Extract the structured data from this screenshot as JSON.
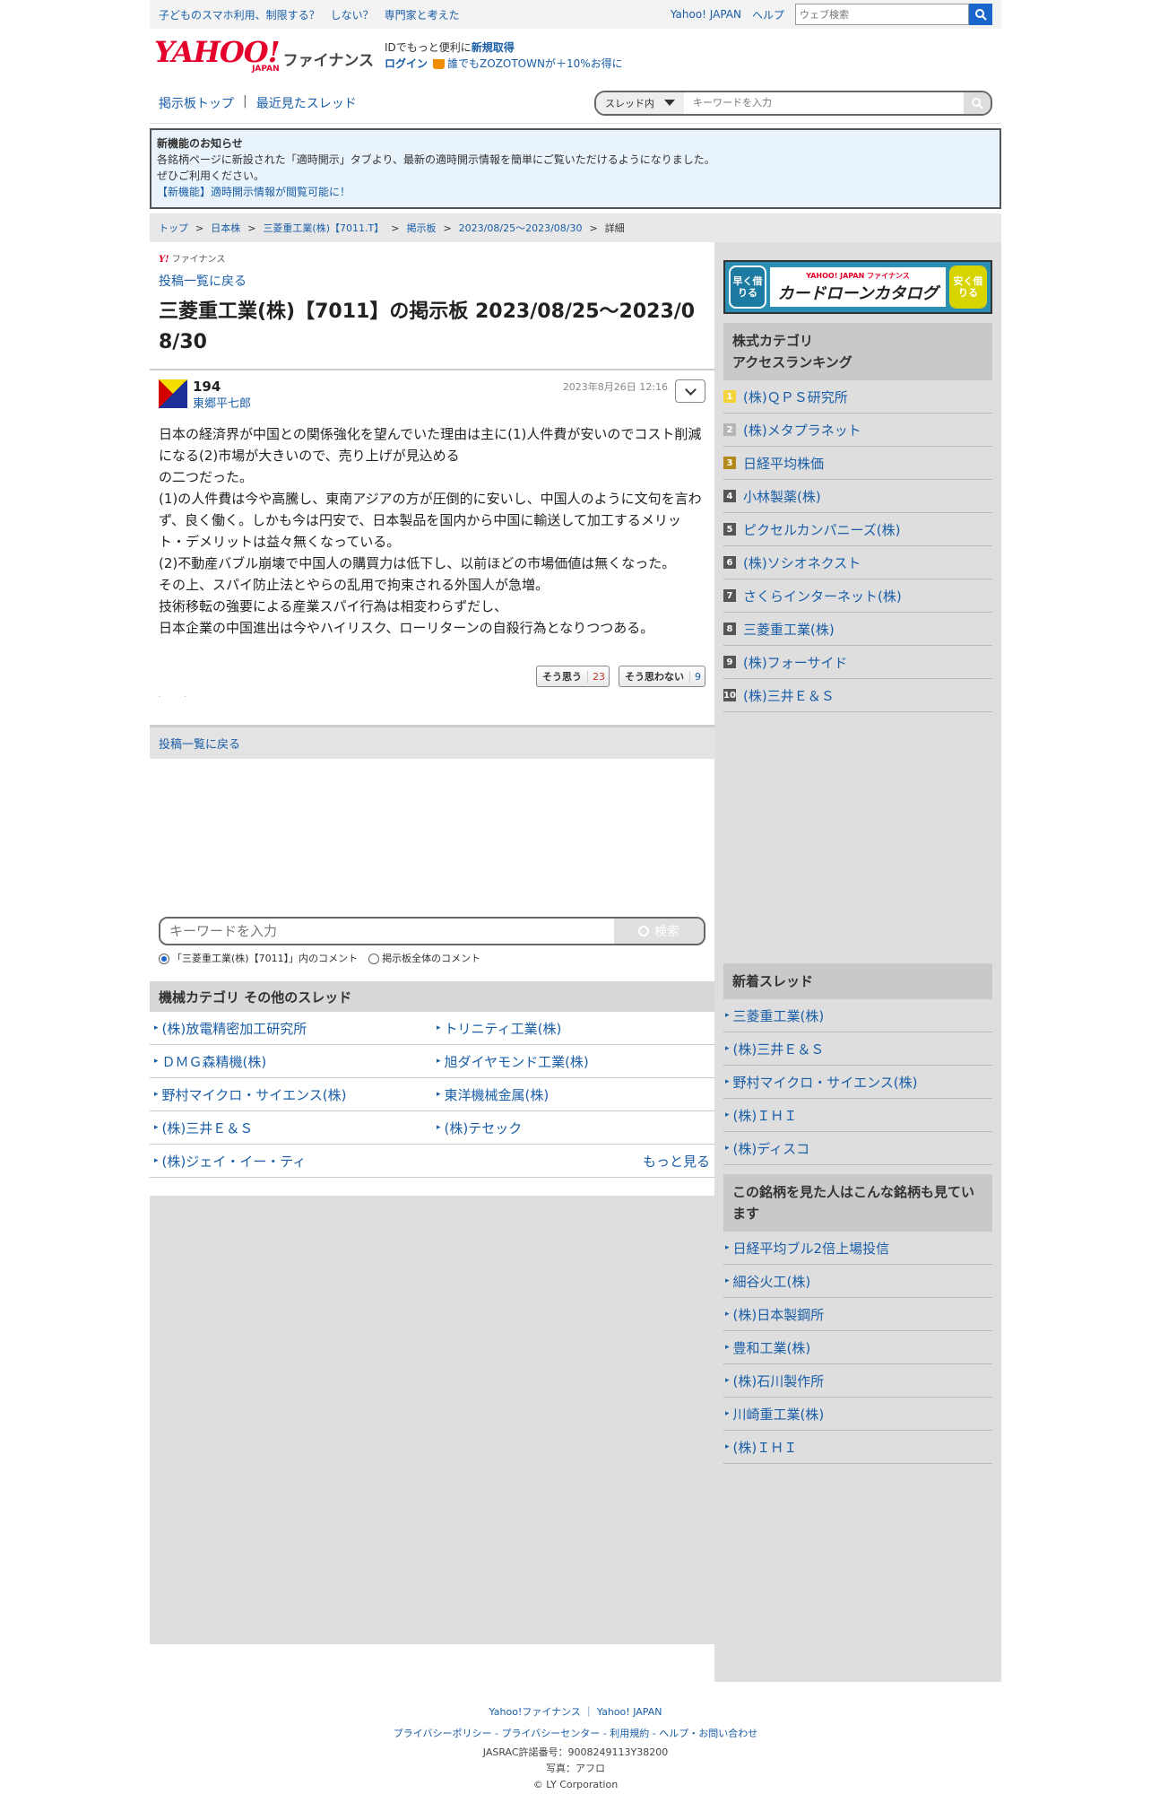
{
  "topbar": {
    "links": [
      "子どものスマホ利用、制限する？　しない？　専門家と考えた"
    ],
    "right_links": [
      "Yahoo! JAPAN",
      "ヘルプ"
    ],
    "search_placeholder": "ウェブ検索"
  },
  "header": {
    "logo_text": "YAHOO!",
    "logo_sub": "JAPAN",
    "service": "ファイナンス",
    "reg_text": "IDでもっと便利に",
    "reg_link": "新規取得",
    "login": "ログイン",
    "promo": "誰でもZOZOTOWNが＋10%お得に"
  },
  "bbsnav": {
    "top": "掲示板トップ",
    "recent": "最近見たスレッド",
    "scope": "スレッド内",
    "placeholder": "キーワードを入力"
  },
  "notice": {
    "title": "新機能のお知らせ",
    "line1": "各銘柄ページに新設された「適時開示」タブより、最新の適時開示情報を簡単にご覧いただけるようになりました。",
    "line2": "ぜひご利用ください。",
    "link": "【新機能】適時開示情報が閲覧可能に！"
  },
  "breadcrumb": [
    "トップ",
    "日本株",
    "三菱重工業(株)【7011.T】",
    "掲示板",
    "2023/08/25〜2023/08/30",
    "詳細"
  ],
  "main": {
    "yfin": "ファイナンス",
    "back": "投稿一覧に戻る",
    "title": "三菱重工業(株)【7011】の掲示板 2023/08/25〜2023/08/30"
  },
  "post": {
    "number": "194",
    "author": "東郷平七郎",
    "date": "2023年8月26日 12:16",
    "lines": [
      "日本の経済界が中国との関係強化を望んでいた理由は主に(1)人件費が安いのでコスト削減になる(2)市場が大きいので、売り上げが見込める",
      "の二つだった。",
      "(1)の人件費は今や高騰し、東南アジアの方が圧倒的に安いし、中国人のように文句を言わず、良く働く。しかも今は円安で、日本製品を国内から中国に輸送して加工するメリット・デメリットは益々無くなっている。",
      "(2)不動産バブル崩壊で中国人の購買力は低下し、以前ほどの市場価値は無くなった。",
      "その上、スパイ防止法とやらの乱用で拘束される外国人が急増。",
      "技術移転の強要による産業スパイ行為は相変わらずだし、",
      "日本企業の中国進出は今やハイリスク、ローリターンの自殺行為となりつつある。"
    ],
    "agree_label": "そう思う",
    "agree_count": "23",
    "disagree_label": "そう思わない",
    "disagree_count": "9"
  },
  "back_bottom": "投稿一覧に戻る",
  "keyword_search": {
    "placeholder": "キーワードを入力",
    "button": "検索",
    "radio1": "「三菱重工業(株)【7011】」内のコメント",
    "radio2": "掲示板全体のコメント"
  },
  "other_threads": {
    "title": "機械カテゴリ  その他のスレッド",
    "items": [
      "(株)放電精密加工研究所",
      "トリニティ工業(株)",
      "ＤＭＧ森精機(株)",
      "旭ダイヤモンド工業(株)",
      "野村マイクロ・サイエンス(株)",
      "東洋機械金属(株)",
      "(株)三井Ｅ＆Ｓ",
      "(株)テセック",
      "(株)ジェイ・イー・ティ"
    ],
    "more": "もっと見る"
  },
  "side": {
    "banner": {
      "left": "早く借りる",
      "brand": "YAHOO! JAPAN ファイナンス",
      "main": "カードローンカタログ",
      "right": "安く借りる"
    },
    "ranking_title_1": "株式カテゴリ",
    "ranking_title_2": "アクセスランキング",
    "ranking": [
      {
        "rank": "1",
        "name": "(株)ＱＰＳ研究所",
        "color": "#f2d33a"
      },
      {
        "rank": "2",
        "name": "(株)メタプラネット",
        "color": "#b5b5b5"
      },
      {
        "rank": "3",
        "name": "日経平均株価",
        "color": "#b38b1d"
      },
      {
        "rank": "4",
        "name": "小林製薬(株)",
        "color": "#555555"
      },
      {
        "rank": "5",
        "name": "ピクセルカンパニーズ(株)",
        "color": "#555555"
      },
      {
        "rank": "6",
        "name": "(株)ソシオネクスト",
        "color": "#555555"
      },
      {
        "rank": "7",
        "name": "さくらインターネット(株)",
        "color": "#555555"
      },
      {
        "rank": "8",
        "name": "三菱重工業(株)",
        "color": "#555555"
      },
      {
        "rank": "9",
        "name": "(株)フォーサイド",
        "color": "#555555"
      },
      {
        "rank": "10",
        "name": "(株)三井Ｅ＆Ｓ",
        "color": "#555555"
      }
    ],
    "new_title": "新着スレッド",
    "new_threads": [
      "三菱重工業(株)",
      "(株)三井Ｅ＆Ｓ",
      "野村マイクロ・サイエンス(株)",
      "(株)ＩＨＩ",
      "(株)ディスコ"
    ],
    "also_title": "この銘柄を見た人はこんな銘柄も見ています",
    "also": [
      "日経平均ブル2倍上場投信",
      "細谷火工(株)",
      "(株)日本製鋼所",
      "豊和工業(株)",
      "(株)石川製作所",
      "川崎重工業(株)",
      "(株)ＩＨＩ"
    ]
  },
  "footer": {
    "links1": [
      "Yahoo!ファイナンス",
      "Yahoo! JAPAN"
    ],
    "links2": [
      "プライバシーポリシー",
      "プライバシーセンター",
      "利用規約",
      "ヘルプ・お問い合わせ"
    ],
    "jasrac": "JASRAC許諾番号：9008249113Y38200",
    "photo": "写真：アフロ",
    "copyright": "© LY Corporation"
  }
}
